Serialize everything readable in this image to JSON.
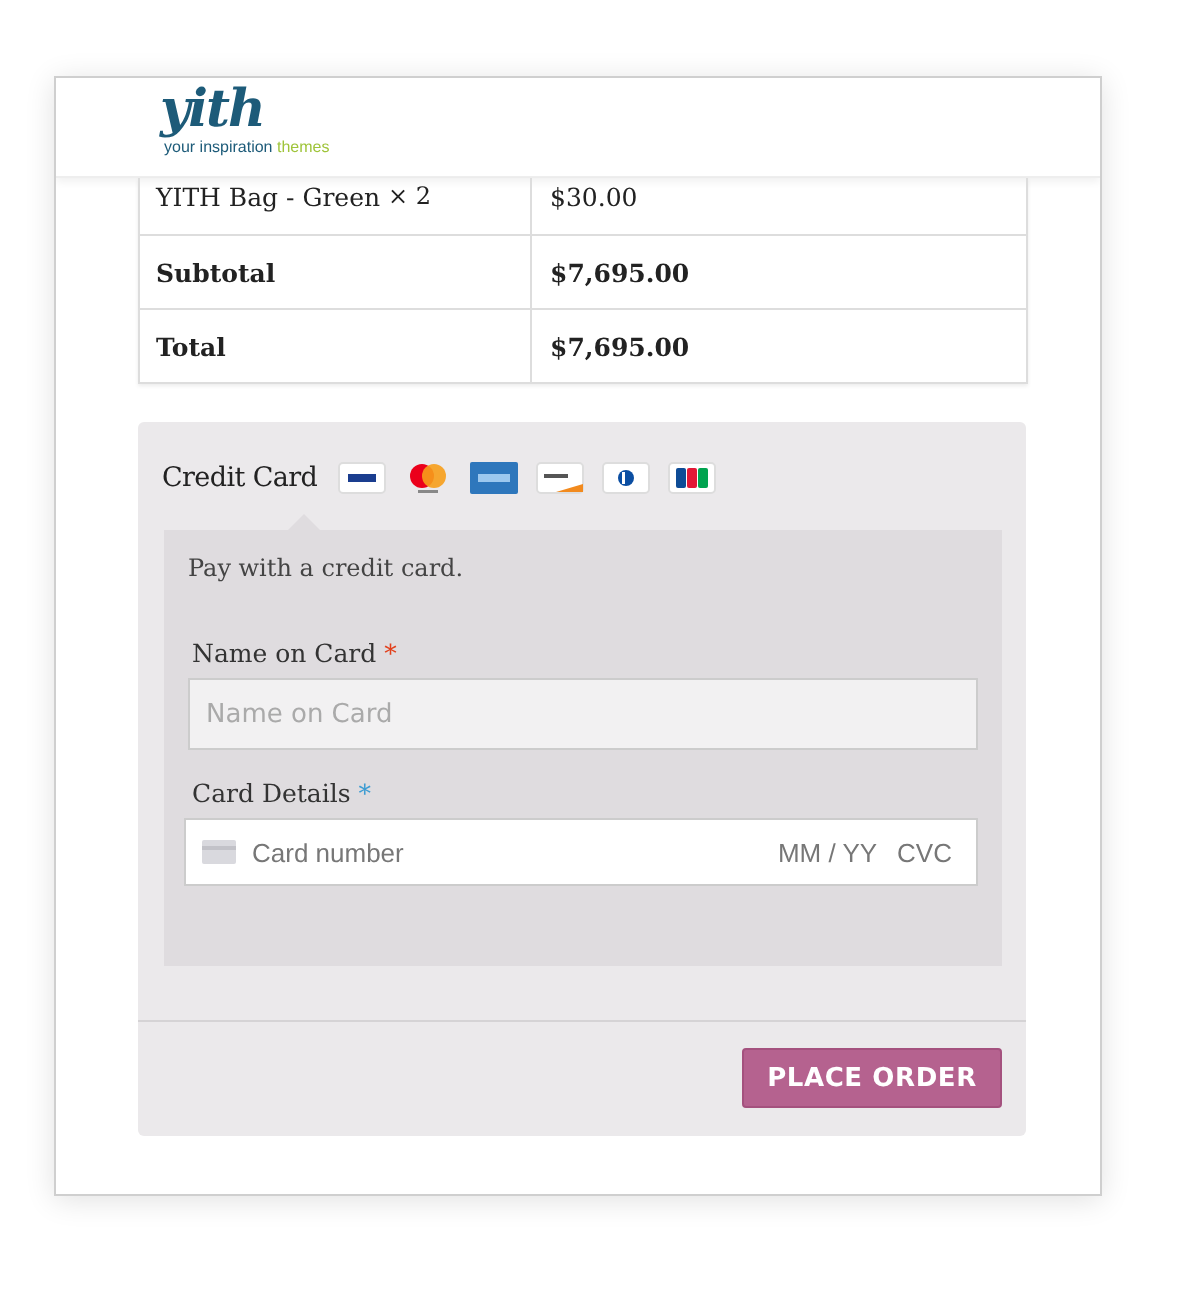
{
  "logo": {
    "wordmark": "yith",
    "tagline": "your inspiration",
    "tagline_accent": "themes"
  },
  "order_table": {
    "rows": [
      {
        "label": "YITH Bag - Green",
        "quantity": "× 2",
        "value": "$30.00",
        "bold": false
      },
      {
        "label": "Subtotal",
        "value": "$7,695.00",
        "bold": true
      },
      {
        "label": "Total",
        "value": "$7,695.00",
        "bold": true
      }
    ]
  },
  "payment": {
    "method": "Credit Card",
    "card_icons": [
      {
        "kind": "visa"
      },
      {
        "kind": "mastercard"
      },
      {
        "kind": "amex"
      },
      {
        "kind": "discover"
      },
      {
        "kind": "diners"
      },
      {
        "kind": "jcb"
      }
    ],
    "description": "Pay with a credit card.",
    "fields": [
      {
        "kind": "text",
        "label": "Name on Card",
        "required_mark": "*",
        "color": "#e2401c",
        "placeholder": "Name on Card"
      },
      {
        "kind": "card",
        "label": "Card Details",
        "required_mark": "*",
        "color": "#3d9cd2",
        "placeholder": "Card number",
        "expiry_placeholder": "MM / YY",
        "cvc_placeholder": "CVC"
      }
    ]
  },
  "place_order_button": "PLACE ORDER"
}
